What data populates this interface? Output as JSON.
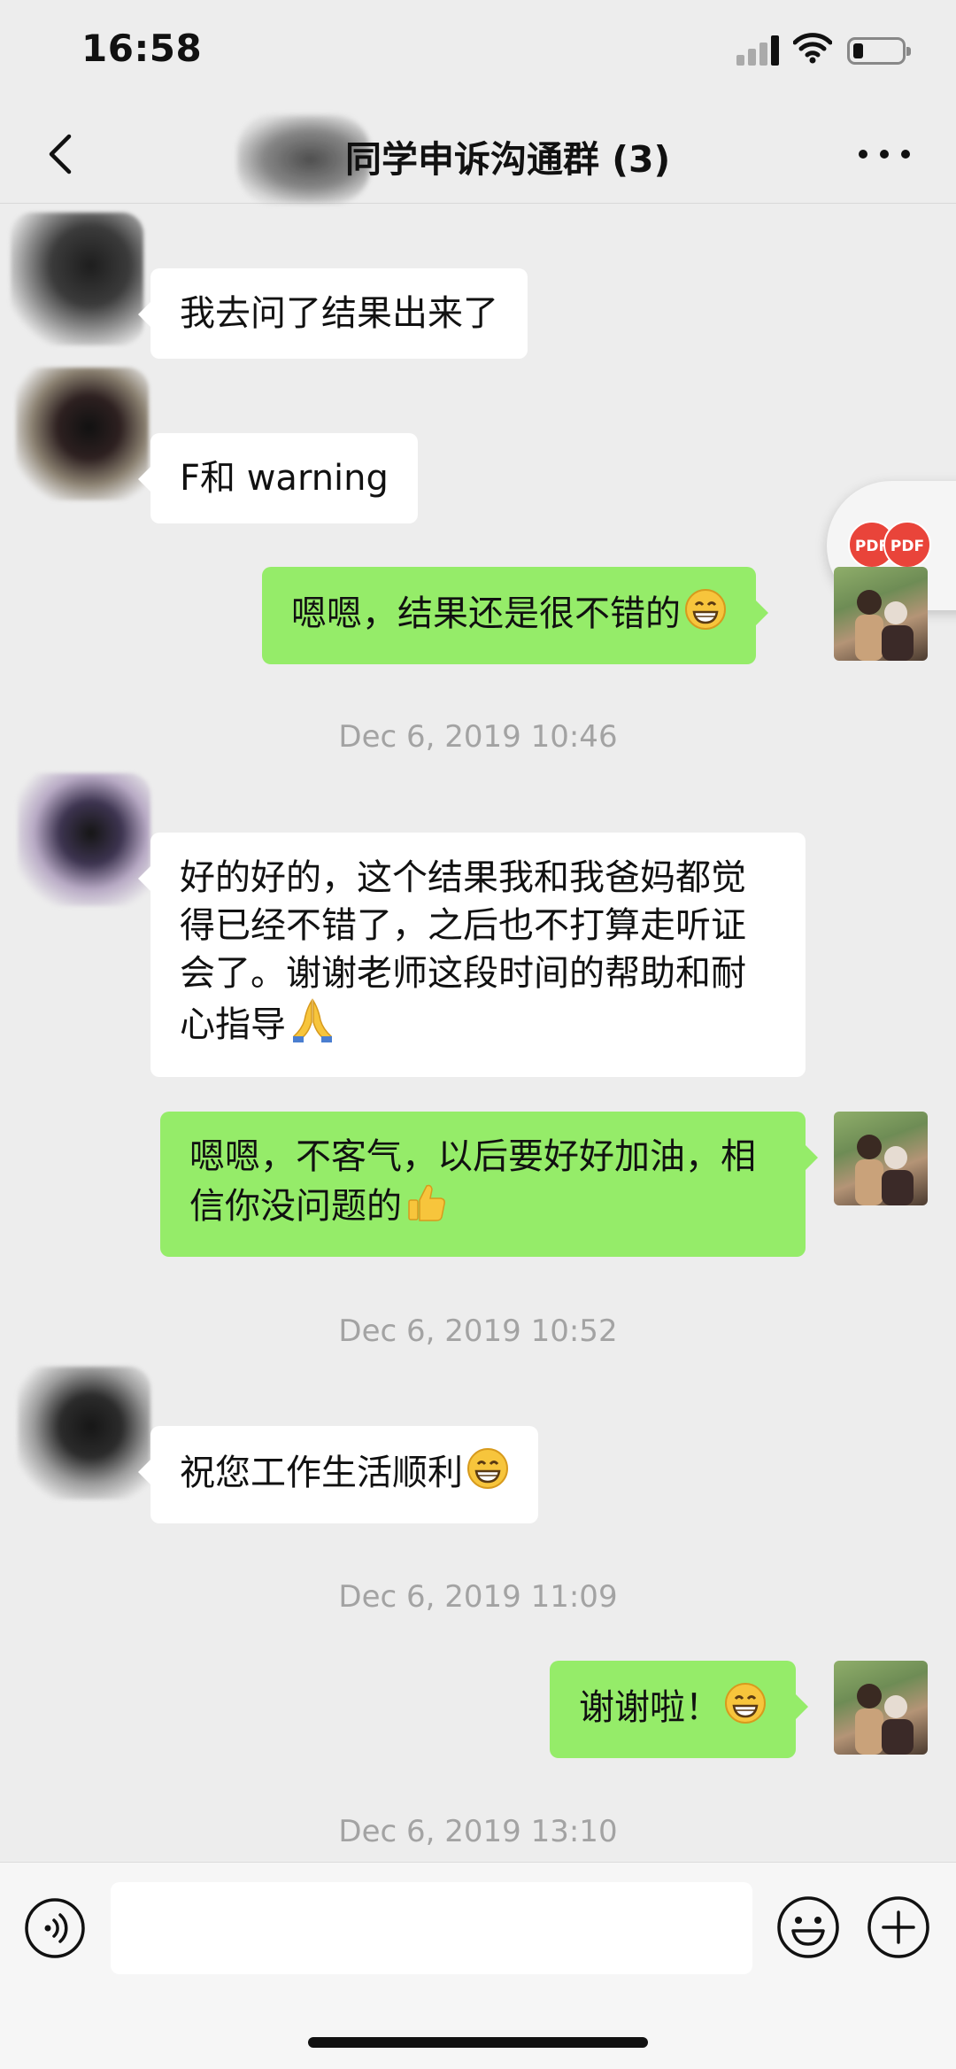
{
  "status_bar": {
    "time": "16:58"
  },
  "header": {
    "title": "同学申诉沟通群 (3)",
    "back_icon": "chevron-left-icon",
    "more_icon": "more-dots-icon"
  },
  "messages": [
    {
      "side": "left",
      "text": "我去问了结果出来了"
    },
    {
      "side": "left",
      "text": "F和 warning"
    },
    {
      "side": "right",
      "text": "嗯嗯，结果还是很不错的",
      "emoji": "grin"
    },
    {
      "timestamp": "Dec 6, 2019 10:46"
    },
    {
      "side": "left",
      "text": "好的好的，这个结果我和我爸妈都觉得已经不错了，之后也不打算走听证会了。谢谢老师这段时间的帮助和耐心指导",
      "emoji": "pray"
    },
    {
      "side": "right",
      "text": "嗯嗯，不客气，以后要好好加油，相信你没问题的",
      "emoji": "thumbs-up"
    },
    {
      "timestamp": "Dec 6, 2019 10:52"
    },
    {
      "side": "left",
      "text": "祝您工作生活顺利",
      "emoji": "grin"
    },
    {
      "timestamp": "Dec 6, 2019 11:09"
    },
    {
      "side": "right",
      "text": "谢谢啦！",
      "emoji": "grin"
    },
    {
      "timestamp": "Dec 6, 2019 13:10"
    }
  ],
  "floating_widget": {
    "badges": [
      "PDF",
      "PDF"
    ]
  },
  "input_bar": {
    "voice_icon": "voice-icon",
    "emoji_icon": "emoji-face-icon",
    "plus_icon": "plus-icon",
    "value": ""
  },
  "colors": {
    "background": "#ededed",
    "bubble_sent": "#95ec69",
    "bubble_received": "#ffffff",
    "timestamp": "#a3a3a3",
    "pdf_badge": "#e9443a"
  }
}
